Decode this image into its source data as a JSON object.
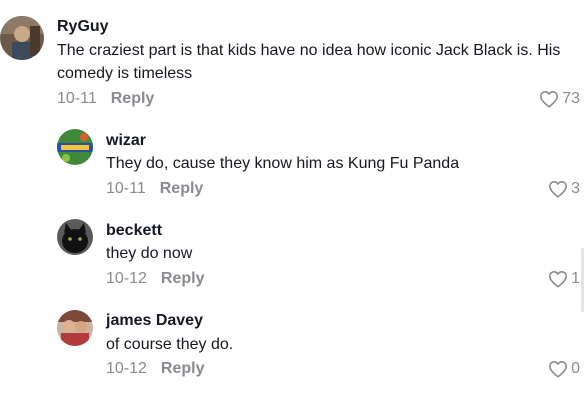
{
  "comments": [
    {
      "username": "RyGuy",
      "text": "The craziest part is that kids have no idea how iconic Jack Black is. His comedy is timeless",
      "date": "10-11",
      "reply_label": "Reply",
      "likes": "73",
      "avatar": "avatar-ryguy"
    },
    {
      "username": "wizar",
      "text": "They do, cause they know him as Kung Fu Panda",
      "date": "10-11",
      "reply_label": "Reply",
      "likes": "3",
      "avatar": "avatar-wizar"
    },
    {
      "username": "beckett",
      "text": "they do now",
      "date": "10-12",
      "reply_label": "Reply",
      "likes": "1",
      "avatar": "avatar-black-cat"
    },
    {
      "username": "james Davey",
      "text": "of course they do.",
      "date": "10-12",
      "reply_label": "Reply",
      "likes": "0",
      "avatar": "avatar-james"
    }
  ],
  "icons": {
    "like": "heart-outline-icon"
  },
  "colors": {
    "text": "#161823",
    "muted": "#8a8b91"
  }
}
